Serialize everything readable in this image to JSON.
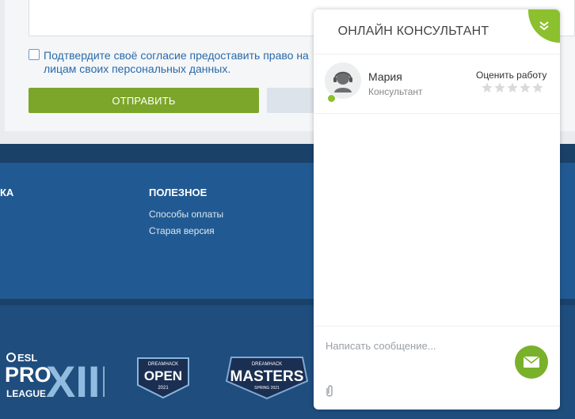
{
  "form": {
    "consent_text": "Подтвердите своё согласие предоставить право на лицам своих персональных данных.",
    "submit_label": "ОТПРАВИТЬ"
  },
  "footer": {
    "col1_heading": "КА",
    "col2_heading": "ПОЛЕЗНОЕ",
    "links": [
      "Способы оплаты",
      "Старая версия"
    ],
    "logos": [
      {
        "name": "ESL Pro League XIII",
        "lines": [
          "ESL",
          "PRO",
          "LEAGUE",
          "XIII"
        ]
      },
      {
        "name": "DreamHack Open 2021",
        "lines": [
          "DREAMHACK",
          "OPEN",
          "2021"
        ]
      },
      {
        "name": "DreamHack Masters Spring 2021",
        "lines": [
          "DREAMHACK",
          "MASTERS",
          "SPRING 2021"
        ]
      }
    ]
  },
  "chat": {
    "title": "ОНЛАЙН КОНСУЛЬТАНТ",
    "agent_name": "Мария",
    "agent_role": "Консультант",
    "rate_label": "Оценить работу",
    "rating": 0,
    "rating_max": 5,
    "message_placeholder": "Написать сообщение..."
  },
  "colors": {
    "accent_green": "#8cc02e",
    "button_green": "#7ca629",
    "footer_blue": "#215a92",
    "link_blue": "#2a6aa8"
  },
  "icons": [
    "chevron-double-down-icon",
    "headset-agent-icon",
    "star-icon",
    "send-mail-icon",
    "paperclip-icon"
  ]
}
